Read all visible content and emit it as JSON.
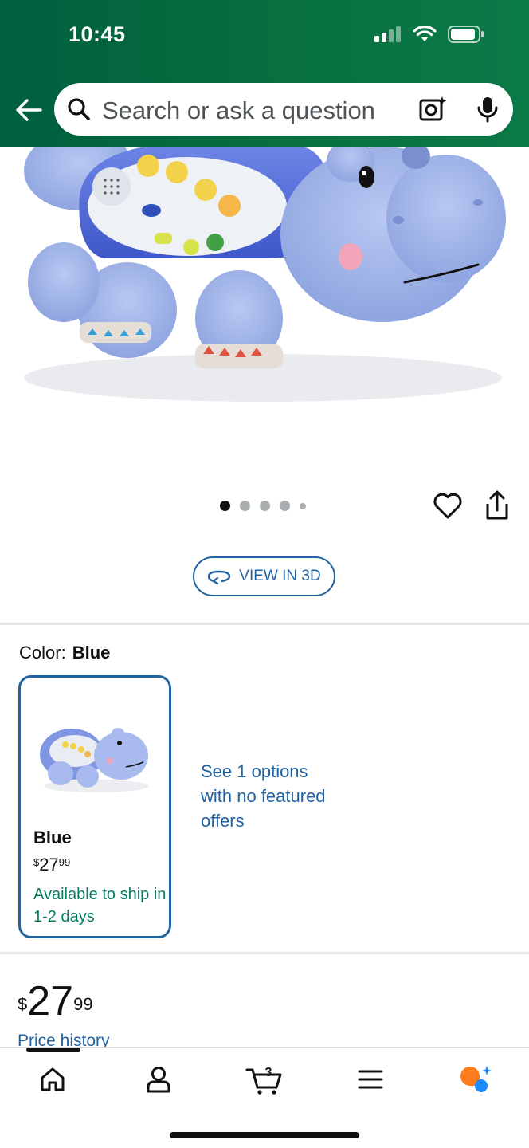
{
  "status_bar": {
    "time": "10:45"
  },
  "search": {
    "placeholder": "Search or ask a question"
  },
  "product": {
    "image_alt": "VTech Lil Critters Soothing Starlight Hippo plush"
  },
  "gallery": {
    "dot_count": 5,
    "active_index": 0
  },
  "view3d": {
    "label": "VIEW IN 3D"
  },
  "color": {
    "label": "Color:",
    "selected": "Blue"
  },
  "swatch": {
    "name": "Blue",
    "price_currency": "$",
    "price_whole": "27",
    "price_fraction": "99",
    "availability": "Available to ship in 1-2 days"
  },
  "options_link": "See 1 options with no featured offers",
  "price": {
    "currency": "$",
    "whole": "27",
    "fraction": "99"
  },
  "price_history": "Price history",
  "bottom_nav": {
    "items": [
      {
        "name": "home",
        "icon": "home-icon"
      },
      {
        "name": "account",
        "icon": "person-icon"
      },
      {
        "name": "cart",
        "icon": "cart-icon",
        "count": "3"
      },
      {
        "name": "menu",
        "icon": "menu-icon"
      },
      {
        "name": "rufus",
        "icon": "rufus-icon"
      }
    ]
  },
  "colors": {
    "header_green": "#08703f",
    "link_blue": "#2162a1",
    "avail_green": "#067d62",
    "rufus_orange": "#ff7a1a",
    "rufus_blue": "#1a8cff"
  }
}
